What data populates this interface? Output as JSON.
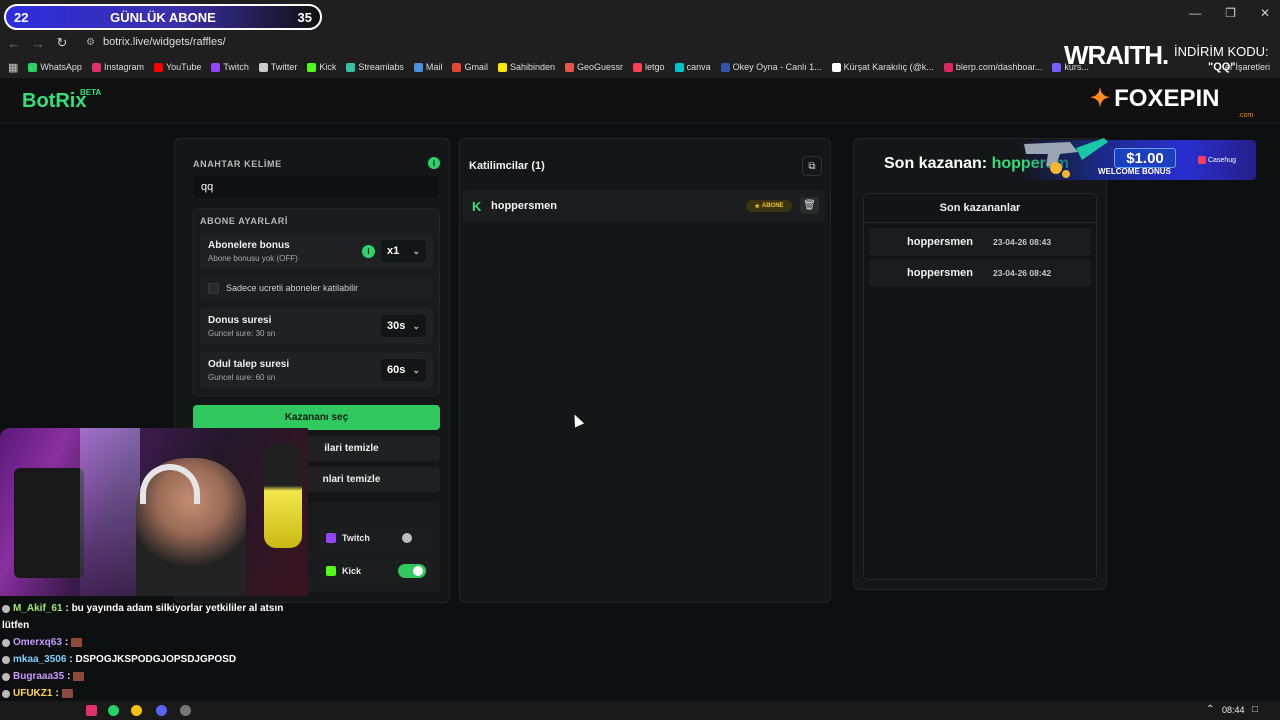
{
  "overlay": {
    "sub_count": "22",
    "sub_label": "GÜNLÜK ABONE",
    "sub_goal": "35",
    "wraith": "WRAITH.",
    "code_label": "İNDİRİM KODU:",
    "code_value": "\"QQ\""
  },
  "browser": {
    "url": "botrix.live/widgets/raffles/",
    "bookmarks": [
      {
        "label": "WhatsApp",
        "color": "#25d366"
      },
      {
        "label": "Instagram",
        "color": "#e1306c"
      },
      {
        "label": "YouTube",
        "color": "#ff0000"
      },
      {
        "label": "Twitch",
        "color": "#9146ff"
      },
      {
        "label": "Twitter",
        "color": "#cccccc"
      },
      {
        "label": "Kick",
        "color": "#53fc18"
      },
      {
        "label": "Streamlabs",
        "color": "#31c3a2"
      },
      {
        "label": "Mail",
        "color": "#4a90e2"
      },
      {
        "label": "Gmail",
        "color": "#ea4335"
      },
      {
        "label": "Sahibinden",
        "color": "#ffe800"
      },
      {
        "label": "GeoGuessr",
        "color": "#e8544e"
      },
      {
        "label": "letgo",
        "color": "#ff3f55"
      },
      {
        "label": "canva",
        "color": "#00c4cc"
      },
      {
        "label": "Okey Oyna - Canlı 1...",
        "color": "#3355aa"
      },
      {
        "label": "Kürşat Karakılıç (@k...",
        "color": "#ffffff"
      },
      {
        "label": "blerp.com/dashboar...",
        "color": "#e0245e"
      },
      {
        "label": "kurs...",
        "color": "#7a5cff"
      }
    ],
    "bookmarks_folder": "er İşaretleri"
  },
  "header": {
    "logo": "BotRix",
    "beta": "BETA",
    "sponsor": "FOXEPIN",
    "sponsor_sub": ".com"
  },
  "left": {
    "keyword_label": "ANAHTAR KELİME",
    "keyword_value": "qq",
    "sub_settings_label": "ABONE AYARLARİ",
    "sub_bonus_title": "Abonelere bonus",
    "sub_bonus_sub": "Abone bonusu yok (OFF)",
    "sub_bonus_value": "x1",
    "paid_only_label": "Sadece ucretli aboneler katilabilir",
    "spin_title": "Donus suresi",
    "spin_sub": "Guncel sure: 30 sn",
    "spin_value": "30s",
    "claim_title": "Odul talep suresi",
    "claim_sub": "Guncel sure: 60 sn",
    "claim_value": "60s",
    "pick_winner": "Kazananı seç",
    "clear_participants": "ilari temizle",
    "clear_winners": "nlari temizle",
    "platforms": [
      {
        "name": "Twitch",
        "on": false,
        "color": "#9146ff"
      },
      {
        "name": "Kick",
        "on": true,
        "color": "#53fc18"
      }
    ]
  },
  "middle": {
    "title": "Katilimcilar (1)",
    "participant": "hoppersmen",
    "badge": "ABONE"
  },
  "right": {
    "last_winner_label": "Son kazanan:",
    "last_winner_name": "hoppersm",
    "winners_title": "Son kazananlar",
    "winners": [
      {
        "name": "hoppersmen",
        "date": "23-04-26 08:43"
      },
      {
        "name": "hoppersmen",
        "date": "23-04-26 08:42"
      }
    ]
  },
  "promo": {
    "amount": "$1.00",
    "text": "WELCOME BONUS",
    "brand": "Casehug"
  },
  "chat": [
    {
      "user": "M_Akif_61",
      "msg": ": bu yayında adam silkiyorlar yetkililer al atsın",
      "color": "#9fe870"
    },
    {
      "user": "",
      "msg": "lütfen",
      "color": "#ffffff"
    },
    {
      "user": "Omerxq63",
      "msg": " :",
      "color": "#c79bff",
      "emote": true
    },
    {
      "user": "mkaa_3506",
      "msg": ": DSPOGJKSPODGJOPSDJGPOSD",
      "color": "#7fd0ff"
    },
    {
      "user": "Bugraaa35",
      "msg": " :",
      "color": "#c79bff",
      "emote": true
    },
    {
      "user": "UFUKZ1",
      "msg": " :",
      "color": "#ffd54a",
      "emote": true
    },
    {
      "user": "Omerxq63",
      "msg": "",
      "color": "#c79bff"
    }
  ],
  "taskbar": {
    "time": "08:44"
  }
}
